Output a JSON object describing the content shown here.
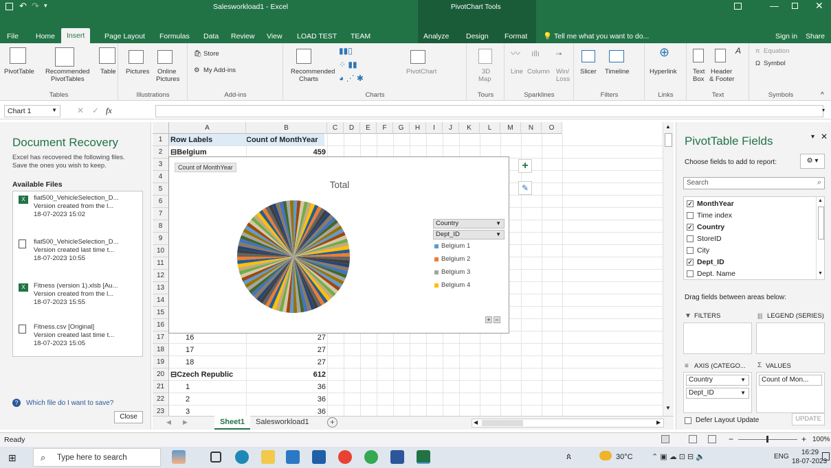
{
  "app": {
    "title": "Salesworkload1 - Excel",
    "context_tools": "PivotChart Tools",
    "sign_in": "Sign in",
    "share": "Share",
    "tell_me": "Tell me what you want to do..."
  },
  "tabs": [
    "File",
    "Home",
    "Insert",
    "Page Layout",
    "Formulas",
    "Data",
    "Review",
    "View",
    "LOAD TEST",
    "TEAM",
    "Analyze",
    "Design",
    "Format"
  ],
  "ribbon": {
    "groups": [
      "Tables",
      "Illustrations",
      "Add-ins",
      "Charts",
      "Tours",
      "Sparklines",
      "Filters",
      "Links",
      "Text",
      "Symbols"
    ],
    "buttons": {
      "pivottable": "PivotTable",
      "recommended_pivot": "Recommended",
      "recommended_pivot2": "PivotTables",
      "table": "Table",
      "pictures": "Pictures",
      "online": "Online",
      "online2": "Pictures",
      "store": "Store",
      "my_addins": "My Add-ins",
      "rec_charts": "Recommended",
      "rec_charts2": "Charts",
      "pivotchart": "PivotChart",
      "map3d": "3D",
      "map3d2": "Map",
      "line": "Line",
      "column": "Column",
      "winloss": "Win/",
      "winloss2": "Loss",
      "slicer": "Slicer",
      "timeline": "Timeline",
      "hyperlink": "Hyperlink",
      "textbox": "Text",
      "textbox2": "Box",
      "header": "Header",
      "header2": "& Footer",
      "equation": "Equation",
      "symbol": "Symbol"
    }
  },
  "formula_bar": {
    "name_box": "Chart 1",
    "fx": "fx",
    "value": ""
  },
  "doc_recovery": {
    "title": "Document Recovery",
    "desc1": "Excel has recovered the following files.",
    "desc2": "Save the ones you wish to keep.",
    "available": "Available Files",
    "files": [
      {
        "name": "fiat500_VehicleSelection_D...",
        "ver": "Version created from the l...",
        "date": "18-07-2023 15:02",
        "icon": "excel"
      },
      {
        "name": "fiat500_VehicleSelection_D...",
        "ver": "Version created last time t...",
        "date": "18-07-2023 10:55",
        "icon": "doc"
      },
      {
        "name": "Fitness (version 1).xlsb [Au...",
        "ver": "Version created from the l...",
        "date": "18-07-2023 15:55",
        "icon": "excel"
      },
      {
        "name": "Fitness.csv [Original]",
        "ver": "Version created last time t...",
        "date": "18-07-2023 15:05",
        "icon": "doc"
      }
    ],
    "which": "Which file do I want to save?",
    "close": "Close"
  },
  "grid": {
    "columns": [
      "A",
      "B",
      "C",
      "D",
      "E",
      "F",
      "G",
      "H",
      "I",
      "J",
      "K",
      "L",
      "M",
      "N",
      "O"
    ],
    "rows": [
      {
        "n": "1",
        "a": "Row Labels",
        "b": "Count of MonthYear",
        "hdr": true
      },
      {
        "n": "2",
        "a": "⊟Belgium",
        "b": "459",
        "bold": true
      },
      {
        "n": "3",
        "a": "",
        "b": ""
      },
      {
        "n": "4",
        "a": "",
        "b": ""
      },
      {
        "n": "5",
        "a": "",
        "b": ""
      },
      {
        "n": "6",
        "a": "",
        "b": ""
      },
      {
        "n": "7",
        "a": "",
        "b": ""
      },
      {
        "n": "8",
        "a": "",
        "b": ""
      },
      {
        "n": "9",
        "a": "",
        "b": ""
      },
      {
        "n": "10",
        "a": "",
        "b": ""
      },
      {
        "n": "11",
        "a": "",
        "b": ""
      },
      {
        "n": "12",
        "a": "",
        "b": ""
      },
      {
        "n": "13",
        "a": "",
        "b": ""
      },
      {
        "n": "14",
        "a": "",
        "b": ""
      },
      {
        "n": "15",
        "a": "",
        "b": ""
      },
      {
        "n": "16",
        "a": "",
        "b": ""
      },
      {
        "n": "17",
        "a": "16",
        "b": "27"
      },
      {
        "n": "18",
        "a": "17",
        "b": "27"
      },
      {
        "n": "19",
        "a": "18",
        "b": "27"
      },
      {
        "n": "20",
        "a": "⊟Czech Republic",
        "b": "612",
        "bold": true
      },
      {
        "n": "21",
        "a": "1",
        "b": "36"
      },
      {
        "n": "22",
        "a": "2",
        "b": "36"
      },
      {
        "n": "23",
        "a": "3",
        "b": "36"
      }
    ]
  },
  "chart": {
    "value_button": "Count of MonthYear",
    "title": "Total",
    "field_buttons": [
      "Country",
      "Dept_ID"
    ],
    "legend": [
      {
        "label": "Belgium 1",
        "color": "#5b9bd5"
      },
      {
        "label": "Belgium 2",
        "color": "#ed7d31"
      },
      {
        "label": "Belgium 3",
        "color": "#a5a5a5"
      },
      {
        "label": "Belgium 4",
        "color": "#ffc000"
      }
    ]
  },
  "sheets": {
    "tabs": [
      "Sheet1",
      "Salesworkload1"
    ],
    "active": "Sheet1"
  },
  "pivot": {
    "title": "PivotTable Fields",
    "choose": "Choose fields to add to report:",
    "search_placeholder": "Search",
    "fields": [
      {
        "label": "MonthYear",
        "checked": true
      },
      {
        "label": "Time index",
        "checked": false
      },
      {
        "label": "Country",
        "checked": true
      },
      {
        "label": "StoreID",
        "checked": false
      },
      {
        "label": "City",
        "checked": false
      },
      {
        "label": "Dept_ID",
        "checked": true
      },
      {
        "label": "Dept. Name",
        "checked": false
      }
    ],
    "drag": "Drag fields between areas below:",
    "filters": "FILTERS",
    "legend": "LEGEND (SERIES)",
    "axis": "AXIS (CATEGO...",
    "values": "VALUES",
    "axis_items": [
      "Country",
      "Dept_ID"
    ],
    "values_items": [
      "Count of Mon..."
    ],
    "defer": "Defer Layout Update",
    "update": "UPDATE"
  },
  "status": {
    "text": "Ready",
    "zoom": "100%"
  },
  "taskbar": {
    "search_placeholder": "Type here to search",
    "weather": "30°C",
    "lang": "ENG",
    "time": "16:29",
    "date": "18-07-2023"
  }
}
